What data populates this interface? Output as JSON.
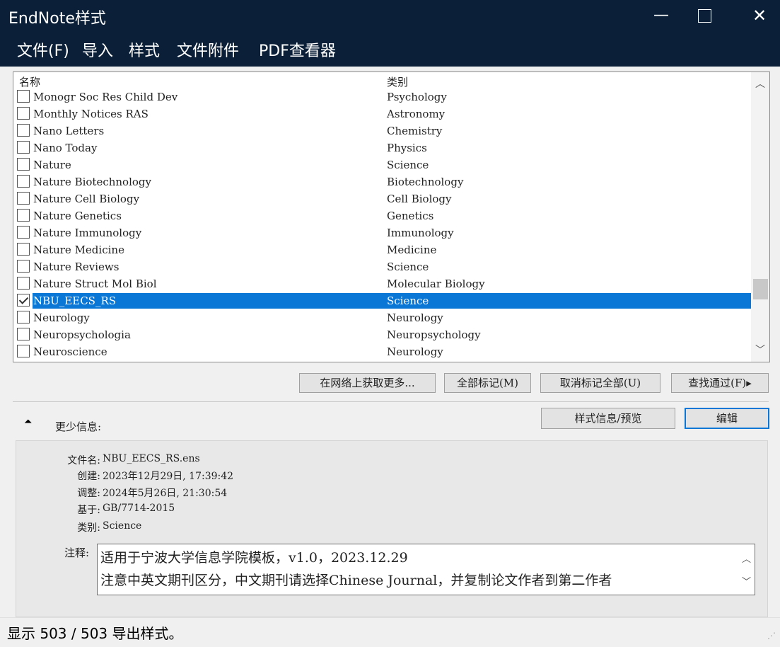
{
  "window": {
    "title": "EndNote样式",
    "minimize": "—",
    "close": "✕"
  },
  "menu": [
    "文件(F)",
    "导入",
    "样式",
    "文件附件",
    "PDF查看器"
  ],
  "list": {
    "col_name": "名称",
    "col_category": "类别",
    "rows": [
      {
        "name": "Monogr Soc Res Child Dev",
        "category": "Psychology",
        "checked": false
      },
      {
        "name": "Monthly Notices RAS",
        "category": "Astronomy",
        "checked": false
      },
      {
        "name": "Nano Letters",
        "category": "Chemistry",
        "checked": false
      },
      {
        "name": "Nano Today",
        "category": "Physics",
        "checked": false
      },
      {
        "name": "Nature",
        "category": "Science",
        "checked": false
      },
      {
        "name": "Nature Biotechnology",
        "category": "Biotechnology",
        "checked": false
      },
      {
        "name": "Nature Cell Biology",
        "category": "Cell Biology",
        "checked": false
      },
      {
        "name": "Nature Genetics",
        "category": "Genetics",
        "checked": false
      },
      {
        "name": "Nature Immunology",
        "category": "Immunology",
        "checked": false
      },
      {
        "name": "Nature Medicine",
        "category": "Medicine",
        "checked": false
      },
      {
        "name": "Nature Reviews",
        "category": "Science",
        "checked": false
      },
      {
        "name": "Nature Struct Mol Biol",
        "category": "Molecular Biology",
        "checked": false
      },
      {
        "name": "NBU_EECS_RS",
        "category": "Science",
        "checked": true,
        "selected": true
      },
      {
        "name": "Neurology",
        "category": "Neurology",
        "checked": false
      },
      {
        "name": "Neuropsychologia",
        "category": "Neuropsychology",
        "checked": false
      },
      {
        "name": "Neuroscience",
        "category": "Neurology",
        "checked": false
      }
    ]
  },
  "buttons": {
    "get_more": "在网络上获取更多...",
    "mark_all": "全部标记(M)",
    "unmark_all": "取消标记全部(U)",
    "find_by": "查找通过(F)▸",
    "style_info": "样式信息/预览",
    "edit": "编辑"
  },
  "details": {
    "toggle_label": "更少信息:",
    "filename_label": "文件名:",
    "filename": "NBU_EECS_RS.ens",
    "created_label": "创建:",
    "created": "2023年12月29日, 17:39:42",
    "modified_label": "调整:",
    "modified": "2024年5月26日, 21:30:54",
    "based_label": "基于:",
    "based": "GB/7714-2015",
    "category_label": "类别:",
    "category": "Science",
    "notes_label": "注释:",
    "notes_line1": "适用于宁波大学信息学院模板，v1.0，2023.12.29",
    "notes_line2": "注意中英文期刊区分，中文期刊请选择Chinese Journal，并复制论文作者到第二作者"
  },
  "status": {
    "text": "显示 503 / 503 导出样式。"
  },
  "colors": {
    "titlebar": "#0b2038",
    "selection": "#0a76d6"
  }
}
